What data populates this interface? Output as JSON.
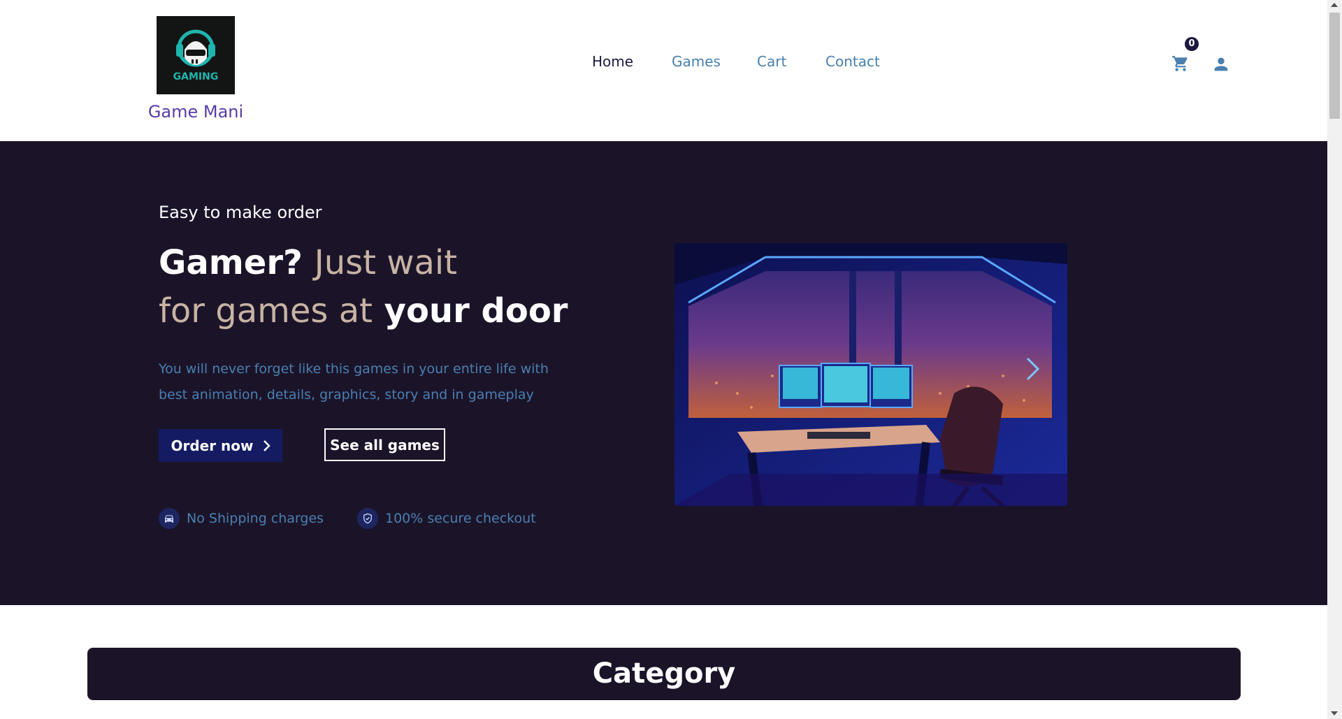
{
  "brand": {
    "name": "Game Mani",
    "logo_text": "GAMING"
  },
  "nav": [
    {
      "label": "Home",
      "active": true
    },
    {
      "label": "Games",
      "active": false
    },
    {
      "label": "Cart",
      "active": false
    },
    {
      "label": "Contact",
      "active": false
    }
  ],
  "header_actions": {
    "cart_icon": "cart-icon",
    "cart_count": "0",
    "user_icon": "user-icon"
  },
  "hero": {
    "eyebrow": "Easy to make order",
    "headline_part1": "Gamer?",
    "headline_part2": "Just wait",
    "headline_part3": "for games at",
    "headline_part4": "your door",
    "lede": "You will never forget like this games in your entire life with best animation, details, graphics, story and in gameplay",
    "order_button": "Order now",
    "all_games_button": "See all games",
    "features": [
      {
        "icon": "car-icon",
        "label": "No Shipping charges"
      },
      {
        "icon": "shield-check-icon",
        "label": "100% secure checkout"
      }
    ]
  },
  "category": {
    "title": "Category"
  },
  "colors": {
    "hero_bg": "#1b1429",
    "accent_blue": "#4a7fb0",
    "brand_purple": "#5a3ba8",
    "button_navy": "#141b62",
    "headline_muted": "#c8b3a4"
  }
}
